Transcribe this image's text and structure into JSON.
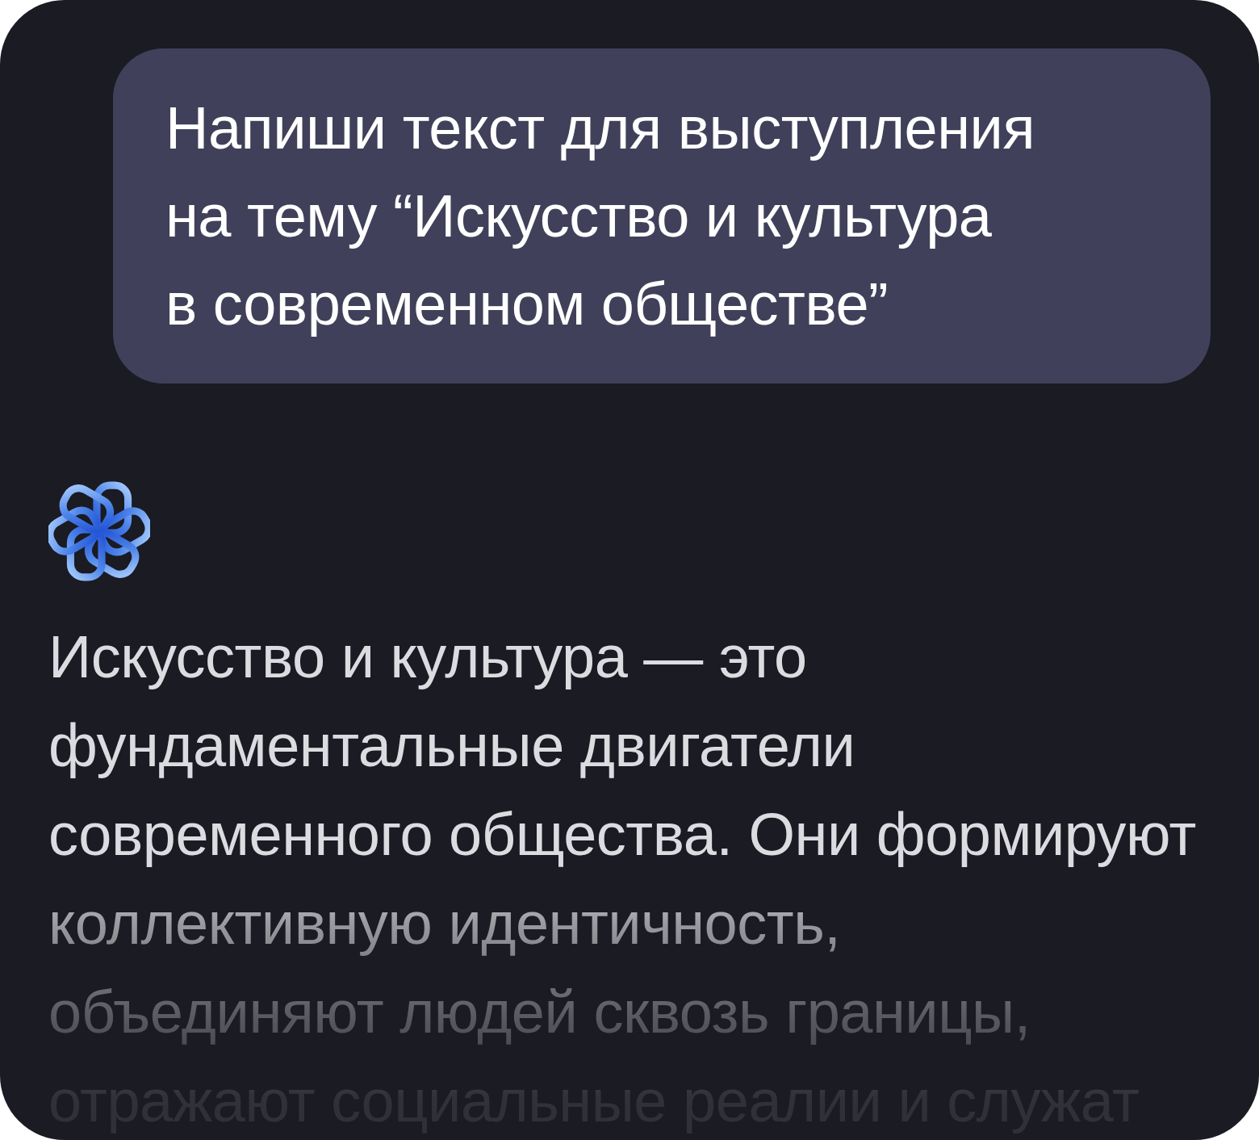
{
  "user_message": {
    "text": "Напиши текст для выступления на тему “Искусство и культура в современном обществе”"
  },
  "assistant_message": {
    "text": "Искусство и культура — это фундаментальные двигатели современного общества. Они формируют коллективную идентичность, объединяют людей сквозь границы, отражают социальные реалии и служат"
  }
}
